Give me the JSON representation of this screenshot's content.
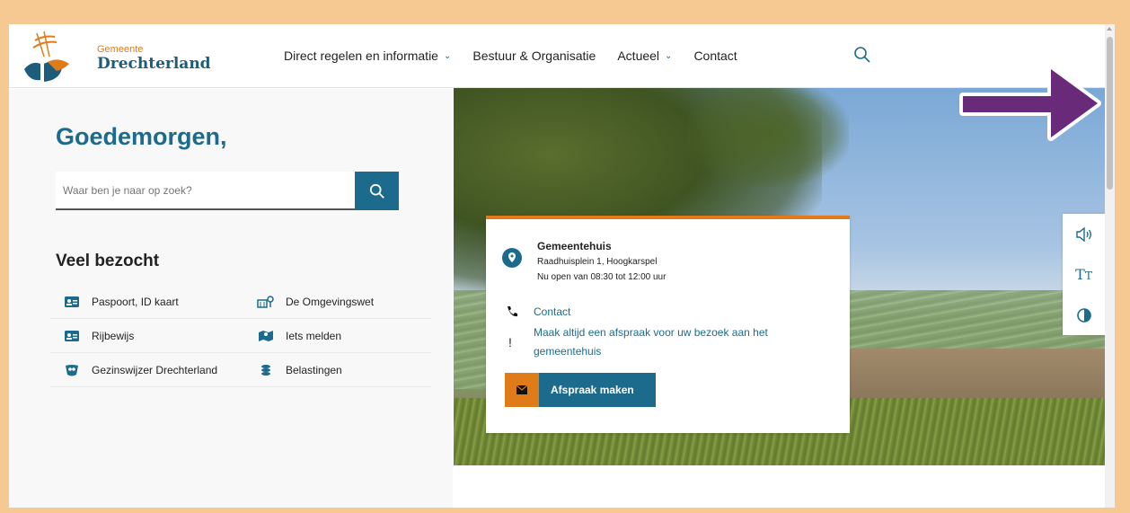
{
  "header": {
    "logo_small": "Gemeente",
    "logo_big": "Drechterland",
    "nav": [
      {
        "label": "Direct regelen en informatie",
        "has_dropdown": true
      },
      {
        "label": "Bestuur & Organisatie",
        "has_dropdown": false
      },
      {
        "label": "Actueel",
        "has_dropdown": true
      },
      {
        "label": "Contact",
        "has_dropdown": false
      }
    ],
    "search_icon": "search-icon"
  },
  "main": {
    "greeting": "Goedemorgen,",
    "search_placeholder": "Waar ben je naar op zoek?",
    "visited_title": "Veel bezocht",
    "visited": [
      {
        "label": "Paspoort, ID kaart",
        "icon": "id-card-icon"
      },
      {
        "label": "De Omgevingswet",
        "icon": "building-icon"
      },
      {
        "label": "Rijbewijs",
        "icon": "id-card-icon"
      },
      {
        "label": "Iets melden",
        "icon": "map-marker-icon"
      },
      {
        "label": "Gezinswijzer Drechterland",
        "icon": "family-icon"
      },
      {
        "label": "Belastingen",
        "icon": "coins-icon"
      }
    ]
  },
  "card": {
    "title": "Gemeentehuis",
    "address": "Raadhuisplein 1, Hoogkarspel",
    "hours": "Nu open van 08:30 tot 12:00 uur",
    "contact_link": "Contact",
    "note": "Maak altijd een afspraak voor uw bezoek aan het gemeentehuis",
    "button": "Afspraak maken"
  },
  "accessibility": [
    "speaker-icon",
    "text-size-icon",
    "contrast-icon"
  ],
  "colors": {
    "accent": "#1d6b8c",
    "orange": "#e07b1a",
    "frame": "#f7c992",
    "arrow": "#6a2a7a"
  }
}
